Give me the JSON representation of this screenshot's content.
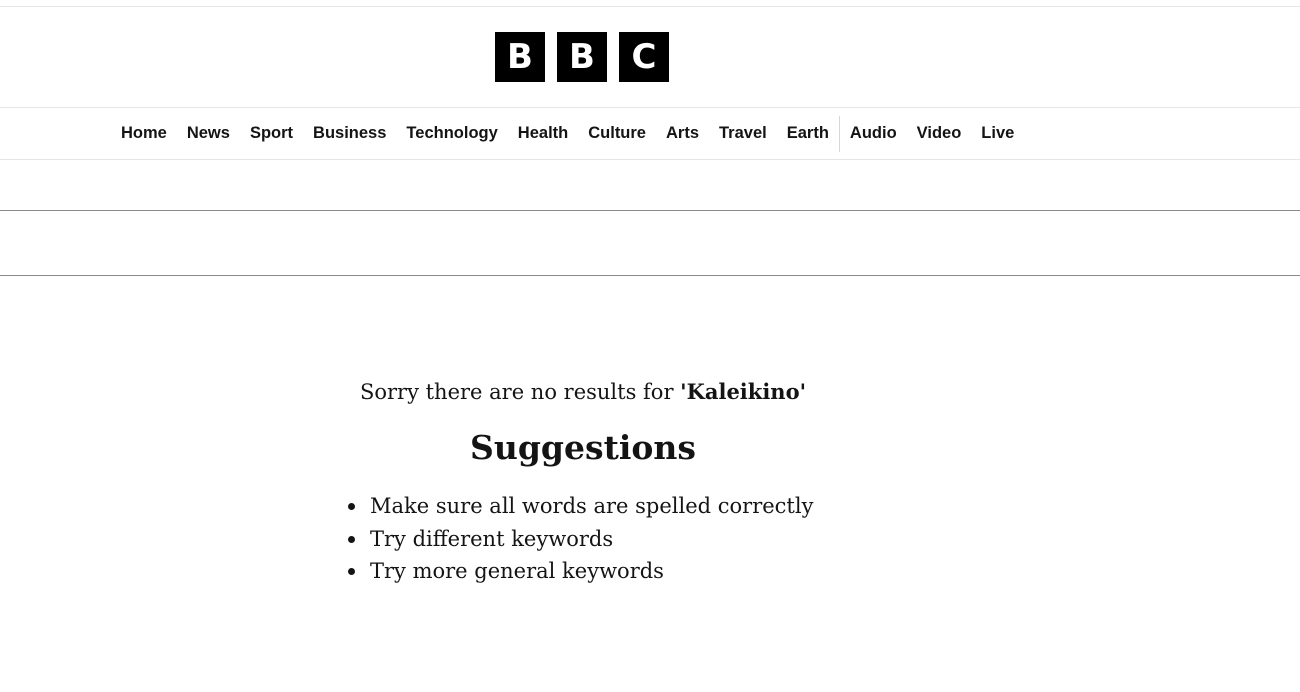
{
  "logo": {
    "letters": [
      "B",
      "B",
      "C"
    ]
  },
  "nav": {
    "items": [
      {
        "label": "Home"
      },
      {
        "label": "News"
      },
      {
        "label": "Sport"
      },
      {
        "label": "Business"
      },
      {
        "label": "Technology"
      },
      {
        "label": "Health"
      },
      {
        "label": "Culture"
      },
      {
        "label": "Arts"
      },
      {
        "label": "Travel"
      },
      {
        "label": "Earth"
      }
    ],
    "secondary_items": [
      {
        "label": "Audio"
      },
      {
        "label": "Video"
      },
      {
        "label": "Live"
      }
    ]
  },
  "search": {
    "no_results_prefix": "Sorry there are no results for ",
    "query_display": "'Kaleikino'"
  },
  "suggestions": {
    "title": "Suggestions",
    "items": [
      "Make sure all words are spelled correctly",
      "Try different keywords",
      "Try more general keywords"
    ]
  }
}
